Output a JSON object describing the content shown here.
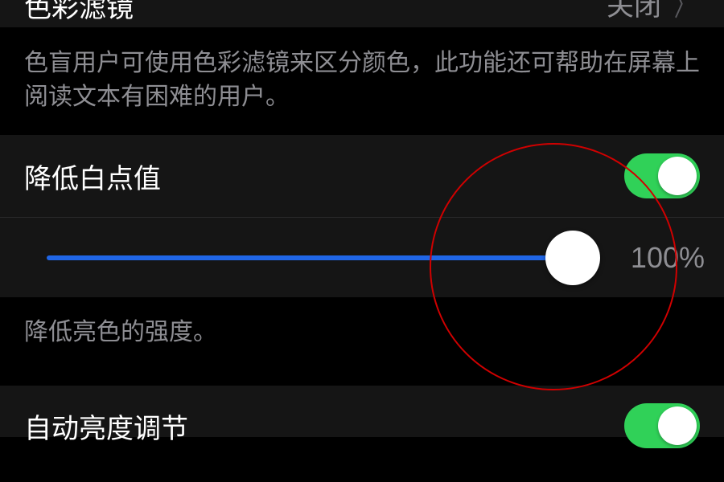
{
  "colorFilter": {
    "label": "色彩滤镜",
    "status": "关闭",
    "description": "色盲用户可使用色彩滤镜来区分颜色，此功能还可帮助在屏幕上阅读文本有困难的用户。"
  },
  "whitePoint": {
    "label": "降低白点值",
    "enabled": true,
    "sliderValue": "100%",
    "description": "降低亮色的强度。"
  },
  "autoBrightness": {
    "label": "自动亮度调节",
    "enabled": true
  }
}
